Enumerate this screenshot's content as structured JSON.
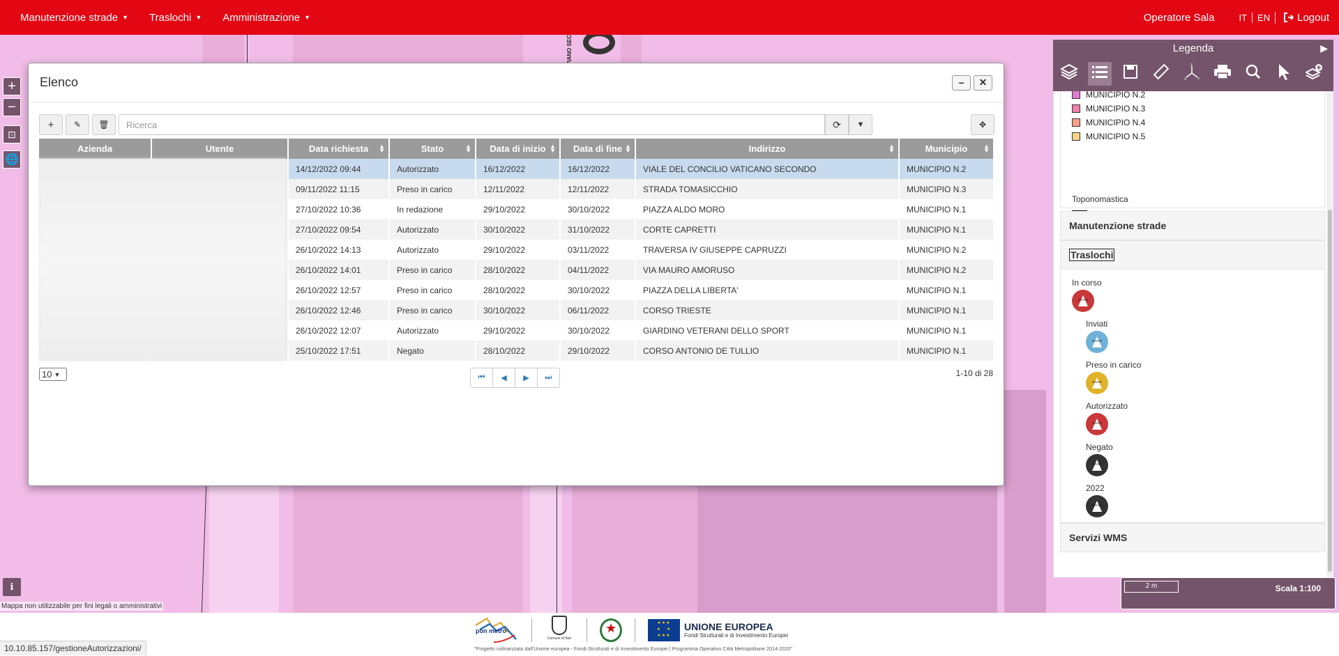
{
  "navbar": {
    "menus": [
      "Manutenzione strade",
      "Traslochi",
      "Amministrazione"
    ],
    "user": "Operatore Sala",
    "languages": [
      "IT",
      "EN"
    ],
    "logout": "Logout"
  },
  "modal": {
    "title": "Elenco",
    "search_placeholder": "Ricerca",
    "columns": [
      "Azienda",
      "Utente",
      "Data richiesta",
      "Stato",
      "Data di inizio",
      "Data di fine",
      "Indirizzo",
      "Municipio"
    ],
    "rows": [
      {
        "data_richiesta": "14/12/2022 09:44",
        "stato": "Autorizzato",
        "inizio": "16/12/2022",
        "fine": "16/12/2022",
        "indirizzo": "VIALE DEL CONCILIO VATICANO SECONDO",
        "municipio": "MUNICIPIO N.2"
      },
      {
        "data_richiesta": "09/11/2022 11:15",
        "stato": "Preso in carico",
        "inizio": "12/11/2022",
        "fine": "12/11/2022",
        "indirizzo": "STRADA TOMASICCHIO",
        "municipio": "MUNICIPIO N.3"
      },
      {
        "data_richiesta": "27/10/2022 10:36",
        "stato": "In redazione",
        "inizio": "29/10/2022",
        "fine": "30/10/2022",
        "indirizzo": "PIAZZA ALDO MORO",
        "municipio": "MUNICIPIO N.1"
      },
      {
        "data_richiesta": "27/10/2022 09:54",
        "stato": "Autorizzato",
        "inizio": "30/10/2022",
        "fine": "31/10/2022",
        "indirizzo": "CORTE CAPRETTI",
        "municipio": "MUNICIPIO N.1"
      },
      {
        "data_richiesta": "26/10/2022 14:13",
        "stato": "Autorizzato",
        "inizio": "29/10/2022",
        "fine": "03/11/2022",
        "indirizzo": "TRAVERSA IV GIUSEPPE CAPRUZZI",
        "municipio": "MUNICIPIO N.2"
      },
      {
        "data_richiesta": "26/10/2022 14:01",
        "stato": "Preso in carico",
        "inizio": "28/10/2022",
        "fine": "04/11/2022",
        "indirizzo": "VIA MAURO AMORUSO",
        "municipio": "MUNICIPIO N.2"
      },
      {
        "data_richiesta": "26/10/2022 12:57",
        "stato": "Preso in carico",
        "inizio": "28/10/2022",
        "fine": "30/10/2022",
        "indirizzo": "PIAZZA DELLA LIBERTA'",
        "municipio": "MUNICIPIO N.1"
      },
      {
        "data_richiesta": "26/10/2022 12:46",
        "stato": "Preso in carico",
        "inizio": "30/10/2022",
        "fine": "06/11/2022",
        "indirizzo": "CORSO TRIESTE",
        "municipio": "MUNICIPIO N.1"
      },
      {
        "data_richiesta": "26/10/2022 12:07",
        "stato": "Autorizzato",
        "inizio": "29/10/2022",
        "fine": "30/10/2022",
        "indirizzo": "GIARDINO VETERANI DELLO SPORT",
        "municipio": "MUNICIPIO N.1"
      },
      {
        "data_richiesta": "25/10/2022 17:51",
        "stato": "Negato",
        "inizio": "28/10/2022",
        "fine": "29/10/2022",
        "indirizzo": "CORSO ANTONIO DE TULLIO",
        "municipio": "MUNICIPIO N.1"
      }
    ],
    "page_size": "10",
    "range": "1-10 di 28"
  },
  "legend": {
    "title": "Legenda",
    "municipi": [
      {
        "label": "MUNICIPIO N.2",
        "color": "#e07ad0"
      },
      {
        "label": "MUNICIPIO N.3",
        "color": "#f27fb0"
      },
      {
        "label": "MUNICIPIO N.4",
        "color": "#f5a08a"
      },
      {
        "label": "MUNICIPIO N.5",
        "color": "#f7d48a"
      }
    ],
    "toponomastica": "Toponomastica",
    "sections": [
      "Manutenzione strade",
      "Traslochi",
      "Servizi WMS"
    ],
    "traslochi_items": [
      {
        "label": "In corso",
        "color": "#c9383a"
      },
      {
        "label": "Inviati",
        "color": "#6fb1d8"
      },
      {
        "label": "Preso in carico",
        "color": "#e0b22a"
      },
      {
        "label": "Autorizzato",
        "color": "#c9383a"
      },
      {
        "label": "Negato",
        "color": "#333333"
      },
      {
        "label": "2022",
        "color": "#333333"
      }
    ]
  },
  "scale": {
    "bar": "2 m",
    "text": "Scala 1:100"
  },
  "disclaimer": "Mappa non utilizzabile per fini legali o amministrativi",
  "footer": {
    "caption": "\"Progetto cofinanziato dall'Unione europea - Fondi Strutturali e di Investimento Europei | Programma Operativo Città Metropolitane 2014-2020\"",
    "eu_title": "UNIONE EUROPEA",
    "eu_sub": "Fondi Strutturali e di Investimento Europei",
    "comune": "Comune di Bari",
    "ponmetro": "pon metro"
  },
  "url": "10.10.85.157/gestioneAutorizzazioni/"
}
